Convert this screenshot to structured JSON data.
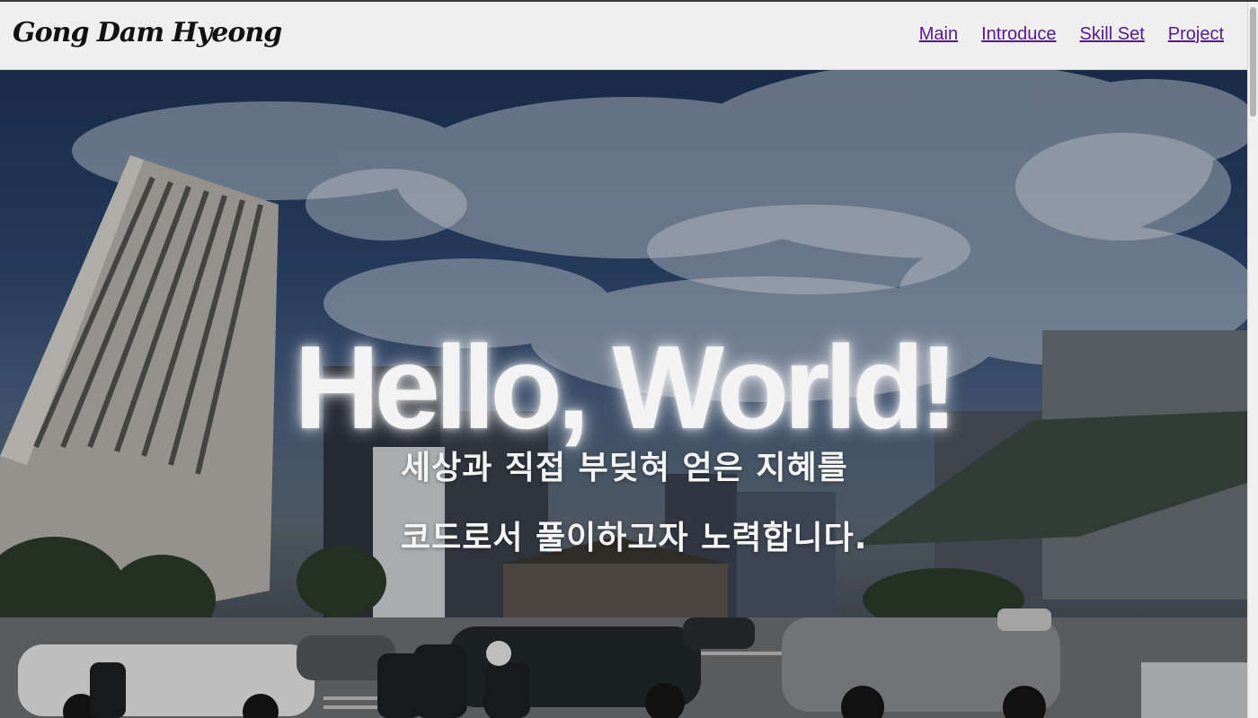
{
  "header": {
    "brand": "Gong Dam Hyeong",
    "nav": [
      {
        "label": "Main"
      },
      {
        "label": "Introduce"
      },
      {
        "label": "Skill Set"
      },
      {
        "label": "Project"
      }
    ]
  },
  "hero": {
    "title": "Hello, World!",
    "line1": "세상과 직접 부딪혀 얻은 지혜를",
    "line2": "코드로서 풀이하고자 노력합니다.",
    "background": "city-street-photo"
  },
  "colors": {
    "nav_link": "#551a8b",
    "header_bg": "#efefef",
    "hero_text": "#f3f3f3"
  }
}
